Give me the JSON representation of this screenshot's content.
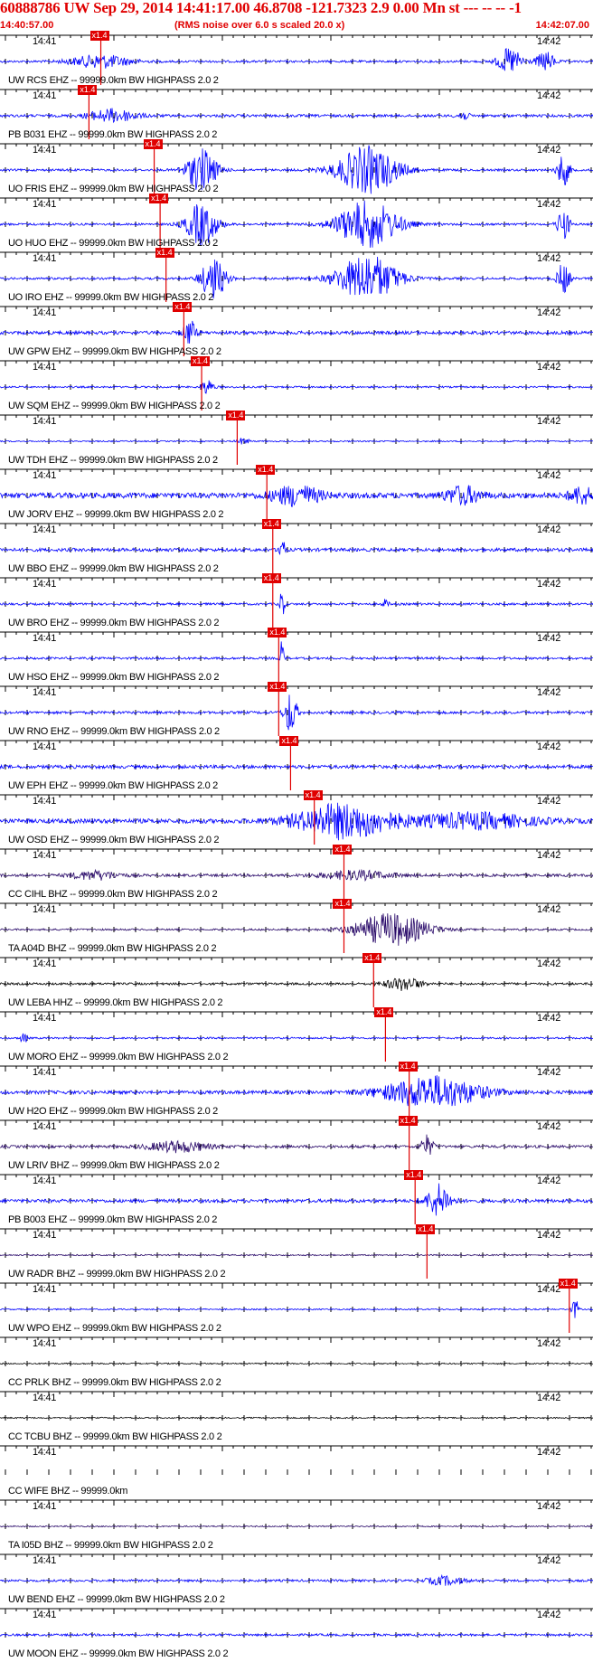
{
  "header": {
    "title": "60888786 UW Sep 29, 2014 14:41:17.00   46.8708 -121.7323  2.9 0.00 Mn st --- -- --   -1",
    "start_time": "14:40:57.00",
    "subtitle": "(RMS noise over 6.0 s scaled 20.0 x)",
    "end_time": "14:42:07.00"
  },
  "tick_labels": {
    "left": "14:41",
    "right": "14:42"
  },
  "pick_label": "x1.4",
  "colors": {
    "blue": "#0000ff",
    "purple": "#2a0a6a",
    "dark": "#000000",
    "pick": "#e00000",
    "title": "#e00000"
  },
  "traces": [
    {
      "label": "UW RCS EHZ -- 99999.0km BW  HIGHPASS  2.0  2",
      "color": "blue",
      "amp": 0.1,
      "pick": 0.17,
      "bursts": [
        [
          0.17,
          0.05,
          0.6
        ],
        [
          0.86,
          0.02,
          1.2
        ],
        [
          0.92,
          0.015,
          0.9
        ]
      ]
    },
    {
      "label": "PB B031 EHZ -- 99999.0km BW  HIGHPASS  2.0  2",
      "color": "blue",
      "amp": 0.12,
      "pick": 0.15,
      "bursts": [
        [
          0.19,
          0.04,
          0.6
        ],
        [
          0.78,
          0.01,
          0.4
        ]
      ]
    },
    {
      "label": "UO FRIS EHZ -- 99999.0km BW  HIGHPASS  2.0  2",
      "color": "blue",
      "amp": 0.1,
      "pick": 0.26,
      "bursts": [
        [
          0.34,
          0.025,
          2.0
        ],
        [
          0.62,
          0.05,
          2.2
        ],
        [
          0.95,
          0.01,
          1.5
        ]
      ]
    },
    {
      "label": "UO HUO EHZ -- 99999.0km BW  HIGHPASS  2.0  2",
      "color": "blue",
      "amp": 0.1,
      "pick": 0.27,
      "bursts": [
        [
          0.34,
          0.025,
          2.0
        ],
        [
          0.62,
          0.05,
          2.2
        ],
        [
          0.95,
          0.01,
          1.5
        ]
      ]
    },
    {
      "label": "UO IRO EHZ -- 99999.0km BW  HIGHPASS  2.0  2",
      "color": "blue",
      "amp": 0.1,
      "pick": 0.28,
      "bursts": [
        [
          0.36,
          0.02,
          2.0
        ],
        [
          0.62,
          0.05,
          2.2
        ],
        [
          0.95,
          0.01,
          1.5
        ]
      ]
    },
    {
      "label": "UW GPW EHZ -- 99999.0km BW  HIGHPASS  2.0  2",
      "color": "blue",
      "amp": 0.15,
      "pick": 0.31,
      "bursts": [
        [
          0.32,
          0.01,
          1.2
        ]
      ]
    },
    {
      "label": "UW SQM EHZ -- 99999.0km BW  HIGHPASS  2.0  2",
      "color": "blue",
      "amp": 0.08,
      "pick": 0.34,
      "bursts": [
        [
          0.35,
          0.01,
          0.7
        ]
      ]
    },
    {
      "label": "UW TDH EHZ -- 99999.0km BW  HIGHPASS  2.0  2",
      "color": "blue",
      "amp": 0.06,
      "pick": 0.4,
      "bursts": [
        [
          0.41,
          0.01,
          0.3
        ]
      ]
    },
    {
      "label": "UW JORV EHZ -- 99999.0km BW  HIGHPASS  2.0  2",
      "color": "blue",
      "amp": 0.25,
      "pick": 0.45,
      "bursts": [
        [
          0.5,
          0.04,
          0.9
        ],
        [
          0.78,
          0.03,
          0.8
        ],
        [
          0.98,
          0.02,
          0.8
        ]
      ]
    },
    {
      "label": "UW BBO EHZ -- 99999.0km BW  HIGHPASS  2.0  2",
      "color": "blue",
      "amp": 0.15,
      "pick": 0.46,
      "bursts": [
        [
          0.475,
          0.004,
          2.0
        ]
      ]
    },
    {
      "label": "UW BRO EHZ -- 99999.0km BW  HIGHPASS  2.0  2",
      "color": "blue",
      "amp": 0.1,
      "pick": 0.46,
      "bursts": [
        [
          0.475,
          0.004,
          1.5
        ],
        [
          0.65,
          0.005,
          0.4
        ]
      ]
    },
    {
      "label": "UW HSO EHZ -- 99999.0km BW  HIGHPASS  2.0  2",
      "color": "blue",
      "amp": 0.1,
      "pick": 0.47,
      "bursts": [
        [
          0.475,
          0.004,
          1.5
        ]
      ]
    },
    {
      "label": "UW RNO EHZ -- 99999.0km BW  HIGHPASS  2.0  2",
      "color": "blue",
      "amp": 0.12,
      "pick": 0.47,
      "bursts": [
        [
          0.49,
          0.01,
          2.0
        ]
      ]
    },
    {
      "label": "UW EPH EHZ -- 99999.0km BW  HIGHPASS  2.0  2",
      "color": "blue",
      "amp": 0.15,
      "pick": 0.49,
      "bursts": []
    },
    {
      "label": "UW OSD EHZ -- 99999.0km BW  HIGHPASS  2.0  2",
      "color": "blue",
      "amp": 0.2,
      "pick": 0.53,
      "bursts": [
        [
          0.58,
          0.08,
          1.6
        ],
        [
          0.8,
          0.1,
          0.7
        ]
      ]
    },
    {
      "label": "CC CIHL BHZ -- 99999.0km BW  HIGHPASS  2.0  2",
      "color": "purple",
      "amp": 0.12,
      "pick": 0.58,
      "bursts": [
        [
          0.16,
          0.04,
          0.4
        ],
        [
          0.6,
          0.06,
          0.4
        ]
      ]
    },
    {
      "label": "TA A04D BHZ -- 99999.0km BW  HIGHPASS  2.0  2",
      "color": "purple",
      "amp": 0.08,
      "pick": 0.58,
      "bursts": [
        [
          0.66,
          0.06,
          1.5
        ]
      ]
    },
    {
      "label": "UW LEBA HHZ -- 99999.0km BW  HIGHPASS  2.0  2",
      "color": "dark",
      "amp": 0.1,
      "pick": 0.63,
      "bursts": [
        [
          0.68,
          0.03,
          0.6
        ]
      ]
    },
    {
      "label": "UW MORO EHZ -- 99999.0km BW  HIGHPASS  2.0  2",
      "color": "blue",
      "amp": 0.08,
      "pick": 0.65,
      "bursts": [
        [
          0.04,
          0.005,
          0.6
        ]
      ]
    },
    {
      "label": "UW H2O EHZ -- 99999.0km BW  HIGHPASS  2.0  2",
      "color": "blue",
      "amp": 0.15,
      "pick": 0.69,
      "bursts": [
        [
          0.73,
          0.08,
          1.5
        ]
      ]
    },
    {
      "label": "UW LRIV BHZ -- 99999.0km BW  HIGHPASS  2.0  2",
      "color": "purple",
      "amp": 0.12,
      "pick": 0.69,
      "bursts": [
        [
          0.3,
          0.05,
          0.5
        ],
        [
          0.72,
          0.01,
          1.0
        ]
      ]
    },
    {
      "label": "PB B003 EHZ -- 99999.0km BW  HIGHPASS  2.0  2",
      "color": "blue",
      "amp": 0.15,
      "pick": 0.7,
      "bursts": [
        [
          0.74,
          0.02,
          1.5
        ]
      ]
    },
    {
      "label": "UW RADR BHZ -- 99999.0km BW  HIGHPASS  2.0  2",
      "color": "purple",
      "amp": 0.06,
      "pick": 0.72,
      "bursts": []
    },
    {
      "label": "UW WPO EHZ -- 99999.0km BW  HIGHPASS  2.0  2",
      "color": "blue",
      "amp": 0.06,
      "pick": 0.96,
      "bursts": [
        [
          0.97,
          0.005,
          1.0
        ]
      ]
    },
    {
      "label": "CC PRLK BHZ -- 99999.0km BW  HIGHPASS  2.0  2",
      "color": "dark",
      "amp": 0.06,
      "pick": null,
      "bursts": []
    },
    {
      "label": "CC TCBU BHZ -- 99999.0km BW  HIGHPASS  2.0  2",
      "color": "dark",
      "amp": 0.06,
      "pick": null,
      "bursts": []
    },
    {
      "label": "CC WIFE BHZ -- 99999.0km",
      "color": "dark",
      "amp": 0.0,
      "pick": null,
      "bursts": []
    },
    {
      "label": "TA I05D BHZ -- 99999.0km BW  HIGHPASS  2.0  2",
      "color": "purple",
      "amp": 0.06,
      "pick": null,
      "bursts": []
    },
    {
      "label": "UW BEND EHZ -- 99999.0km BW  HIGHPASS  2.0  2",
      "color": "blue",
      "amp": 0.1,
      "pick": null,
      "bursts": [
        [
          0.75,
          0.03,
          0.4
        ]
      ]
    },
    {
      "label": "UW MOON EHZ -- 99999.0km BW  HIGHPASS  2.0  2",
      "color": "blue",
      "amp": 0.1,
      "pick": null,
      "bursts": []
    }
  ]
}
